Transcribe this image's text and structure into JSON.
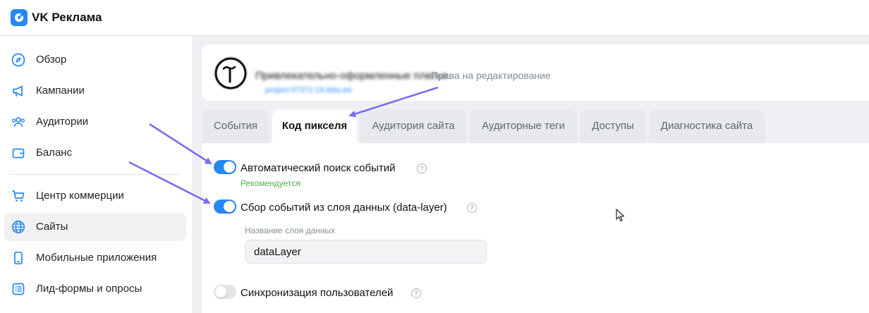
{
  "app": {
    "brand": "VK Реклама"
  },
  "sidebar": {
    "items": [
      {
        "label": "Обзор",
        "icon": "compass-icon"
      },
      {
        "label": "Кампании",
        "icon": "megaphone-icon"
      },
      {
        "label": "Аудитории",
        "icon": "users-icon"
      },
      {
        "label": "Баланс",
        "icon": "wallet-icon"
      },
      {
        "label": "Центр коммерции",
        "icon": "cart-icon"
      },
      {
        "label": "Сайты",
        "icon": "globe-icon",
        "active": true
      },
      {
        "label": "Мобильные приложения",
        "icon": "smartphone-icon"
      },
      {
        "label": "Лид-формы и опросы",
        "icon": "list-icon"
      }
    ]
  },
  "site": {
    "name": "Привлекательно-оформленные платья",
    "separator": "·",
    "rights": "Права на редактирование",
    "url": "project-57372-19.tilda.ws"
  },
  "tabs": [
    {
      "label": "События"
    },
    {
      "label": "Код пикселя",
      "active": true
    },
    {
      "label": "Аудитория сайта"
    },
    {
      "label": "Аудиторные теги"
    },
    {
      "label": "Доступы"
    },
    {
      "label": "Диагностика сайта"
    }
  ],
  "settings": {
    "auto_search": {
      "label": "Автоматический поиск событий",
      "enabled": true,
      "note": "Рекомендуется"
    },
    "data_layer": {
      "label": "Сбор событий из слоя данных (data-layer)",
      "enabled": true,
      "field_label": "Название слоя данных",
      "field_value": "dataLayer"
    },
    "sync_users": {
      "label": "Синхронизация пользователей",
      "enabled": false
    }
  },
  "colors": {
    "accent": "#2787f5",
    "recommended": "#4bb34b",
    "arrow": "#7b6cf0"
  }
}
